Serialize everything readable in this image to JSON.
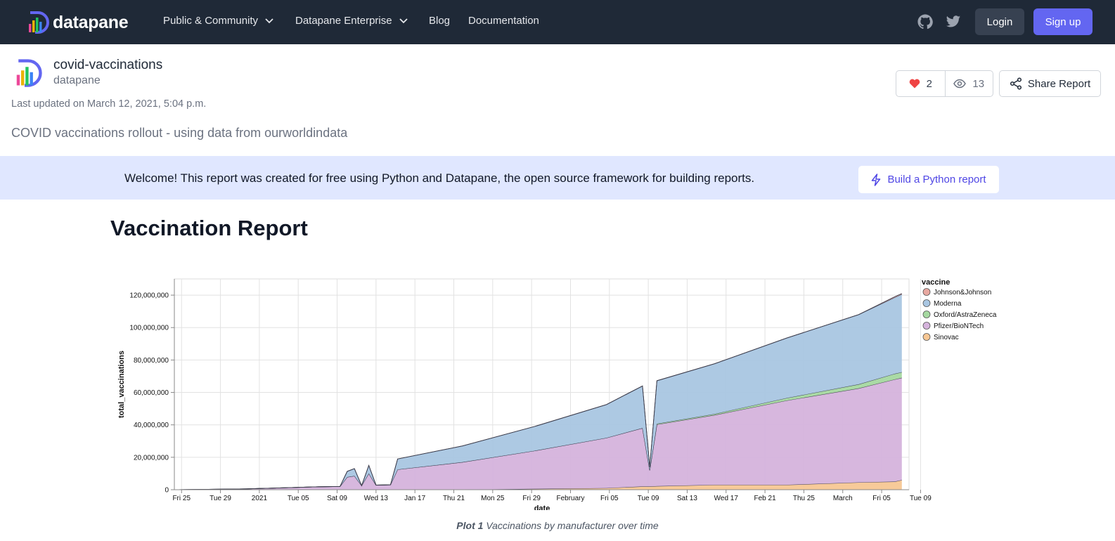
{
  "nav": {
    "brand": "datapane",
    "links": [
      "Public & Community",
      "Datapane Enterprise",
      "Blog",
      "Documentation"
    ],
    "login": "Login",
    "signup": "Sign up",
    "icons": [
      "github-icon",
      "twitter-icon"
    ]
  },
  "report": {
    "name": "covid-vaccinations",
    "owner": "datapane",
    "updated": "Last updated on March 12, 2021, 5:04 p.m.",
    "description": "COVID vaccinations rollout - using data from ourworldindata",
    "likes": "2",
    "views": "13",
    "share_label": "Share Report"
  },
  "banner": {
    "text": "Welcome! This report was created for free using Python and Datapane, the open source framework for building reports.",
    "button": "Build a Python report"
  },
  "page_title": "Vaccination Report",
  "caption": {
    "prefix": "Plot 1",
    "text": "Vaccinations by manufacturer over time"
  },
  "colors": {
    "nav_bg": "#1f2937",
    "accent": "#6366f1",
    "banner_bg": "#e0e7ff",
    "heart": "#ef4444"
  },
  "chart_data": {
    "type": "area",
    "stacked": true,
    "xlabel": "date",
    "ylabel": "total_vaccinations",
    "ylim": [
      0,
      130000000
    ],
    "y_ticks": [
      "0",
      "20,000,000",
      "40,000,000",
      "60,000,000",
      "80,000,000",
      "100,000,000",
      "120,000,000"
    ],
    "x_ticks": [
      "Fri 25",
      "Tue 29",
      "2021",
      "Tue 05",
      "Sat 09",
      "Wed 13",
      "Jan 17",
      "Thu 21",
      "Mon 25",
      "Fri 29",
      "February",
      "Fri 05",
      "Tue 09",
      "Sat 13",
      "Wed 17",
      "Feb 21",
      "Thu 25",
      "March",
      "Fri 05",
      "Tue 09"
    ],
    "legend_title": "vaccine",
    "legend_position": "right",
    "grid": true,
    "series": [
      {
        "name": "Johnson&Johnson",
        "color": "#e8a8a0"
      },
      {
        "name": "Moderna",
        "color": "#a9c6e2"
      },
      {
        "name": "Oxford/AstraZeneca",
        "color": "#a5d8a0"
      },
      {
        "name": "Pfizer/BioNTech",
        "color": "#d5b3dc"
      },
      {
        "name": "Sinovac",
        "color": "#f7c794"
      }
    ],
    "points": [
      {
        "day": 0,
        "sinovac": 0,
        "pfizer": 0,
        "oxford": 0,
        "moderna": 0,
        "jj": 0
      },
      {
        "day": 10,
        "sinovac": 0,
        "pfizer": 500000,
        "oxford": 0,
        "moderna": 0,
        "jj": 0
      },
      {
        "day": 20,
        "sinovac": 0,
        "pfizer": 1800000,
        "oxford": 0,
        "moderna": 0,
        "jj": 0
      },
      {
        "day": 23,
        "sinovac": 0,
        "pfizer": 2000000,
        "oxford": 0,
        "moderna": 0,
        "jj": 0
      },
      {
        "day": 24,
        "sinovac": 0,
        "pfizer": 7800000,
        "oxford": 0,
        "moderna": 3500000,
        "jj": 0
      },
      {
        "day": 25,
        "sinovac": 0,
        "pfizer": 8500000,
        "oxford": 0,
        "moderna": 4500000,
        "jj": 0
      },
      {
        "day": 26,
        "sinovac": 0,
        "pfizer": 2500000,
        "oxford": 0,
        "moderna": 0,
        "jj": 0
      },
      {
        "day": 27,
        "sinovac": 0,
        "pfizer": 10000000,
        "oxford": 0,
        "moderna": 5000000,
        "jj": 0
      },
      {
        "day": 28,
        "sinovac": 0,
        "pfizer": 2800000,
        "oxford": 0,
        "moderna": 0,
        "jj": 0
      },
      {
        "day": 30,
        "sinovac": 0,
        "pfizer": 3000000,
        "oxford": 0,
        "moderna": 0,
        "jj": 0
      },
      {
        "day": 31,
        "sinovac": 0,
        "pfizer": 12500000,
        "oxford": 0,
        "moderna": 6500000,
        "jj": 0
      },
      {
        "day": 40,
        "sinovac": 0,
        "pfizer": 17000000,
        "oxford": 0,
        "moderna": 10000000,
        "jj": 0
      },
      {
        "day": 50,
        "sinovac": 500000,
        "pfizer": 23500000,
        "oxford": 0,
        "moderna": 15000000,
        "jj": 0
      },
      {
        "day": 60,
        "sinovac": 1000000,
        "pfizer": 31000000,
        "oxford": 0,
        "moderna": 20500000,
        "jj": 0
      },
      {
        "day": 65,
        "sinovac": 2000000,
        "pfizer": 36000000,
        "oxford": 0,
        "moderna": 26000000,
        "jj": 0
      },
      {
        "day": 66,
        "sinovac": 2000000,
        "pfizer": 10000000,
        "oxford": 0,
        "moderna": 2000000,
        "jj": 0
      },
      {
        "day": 67,
        "sinovac": 2200000,
        "pfizer": 38000000,
        "oxford": 500000,
        "moderna": 26500000,
        "jj": 0
      },
      {
        "day": 75,
        "sinovac": 3000000,
        "pfizer": 43000000,
        "oxford": 700000,
        "moderna": 31000000,
        "jj": 0
      },
      {
        "day": 85,
        "sinovac": 3000000,
        "pfizer": 52000000,
        "oxford": 1500000,
        "moderna": 37000000,
        "jj": 0
      },
      {
        "day": 95,
        "sinovac": 4500000,
        "pfizer": 58000000,
        "oxford": 2500000,
        "moderna": 43000000,
        "jj": 0
      },
      {
        "day": 100,
        "sinovac": 5000000,
        "pfizer": 63000000,
        "oxford": 3500000,
        "moderna": 47000000,
        "jj": 500000
      },
      {
        "day": 101,
        "sinovac": 6000000,
        "pfizer": 63000000,
        "oxford": 3500000,
        "moderna": 48000000,
        "jj": 500000
      }
    ]
  }
}
